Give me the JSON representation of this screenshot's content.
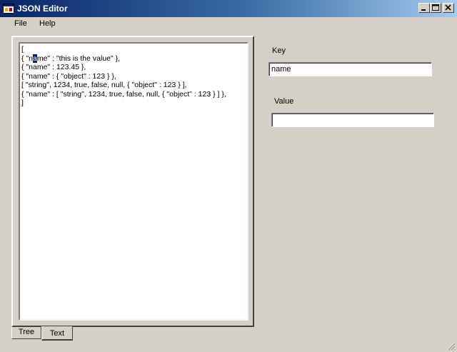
{
  "window": {
    "title": "JSON Editor",
    "icon": "app-window-icon",
    "controls": [
      "minimize-icon",
      "maximize-icon",
      "close-icon"
    ]
  },
  "menu": {
    "file": "File",
    "help": "Help"
  },
  "editor": {
    "lines": [
      {
        "text": "["
      },
      {
        "before": "{ \"n",
        "selected": "a",
        "after": "me\" : \"this is the value\" },"
      },
      {
        "text": "{ \"name\" : 123.45 },"
      },
      {
        "text": "{ \"name\" : { \"object\" : 123 } },"
      },
      {
        "text": "[ \"string\", 1234, true, false, null, { \"object\" : 123 } ],"
      },
      {
        "text": "{ \"name\" : [ \"string\", 1234, true, false, null, { \"object\" : 123 } ] },"
      },
      {
        "text": "]"
      }
    ]
  },
  "tabs": {
    "tree": "Tree",
    "text": "Text",
    "active": "Text"
  },
  "fields": {
    "key_label": "Key",
    "key_value": "name",
    "value_label": "Value",
    "value_value": ""
  },
  "colors": {
    "face": "#d4d0c8",
    "title_start": "#0a246a",
    "title_end": "#a6caf0",
    "selection": "#0a246a"
  }
}
